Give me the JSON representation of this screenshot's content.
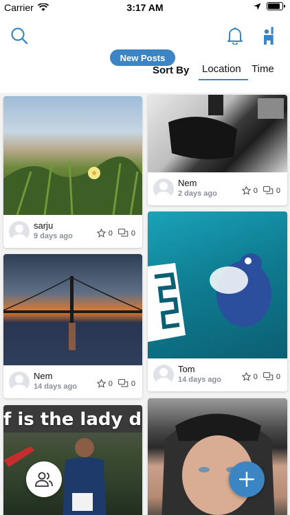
{
  "status_bar": {
    "carrier": "Carrier",
    "time": "3:17 AM",
    "battery_level": 0.9
  },
  "header": {
    "new_posts_label": "New Posts",
    "sort_by_label": "Sort By",
    "sort_options": [
      "Location",
      "Time"
    ],
    "selected_sort": "Location",
    "accent_color": "#3b85c4"
  },
  "icons": {
    "search": "search-icon",
    "notifications": "bell-icon",
    "profile": "person-raising-hand-icon",
    "people": "people-icon",
    "add": "plus-icon",
    "star": "star-icon",
    "comment": "comment-icon"
  },
  "posts": [
    {
      "user": "sarju",
      "ago": "9 days ago",
      "stars": "0",
      "comments": "0"
    },
    {
      "user": "Nem",
      "ago": "2 days ago",
      "stars": "0",
      "comments": "0"
    },
    {
      "user": "Nem",
      "ago": "14 days ago",
      "stars": "0",
      "comments": "0"
    },
    {
      "user": "Tom",
      "ago": "14 days ago",
      "stars": "0",
      "comments": "0"
    },
    {
      "overlay_text": "f is the lady doir"
    }
  ]
}
